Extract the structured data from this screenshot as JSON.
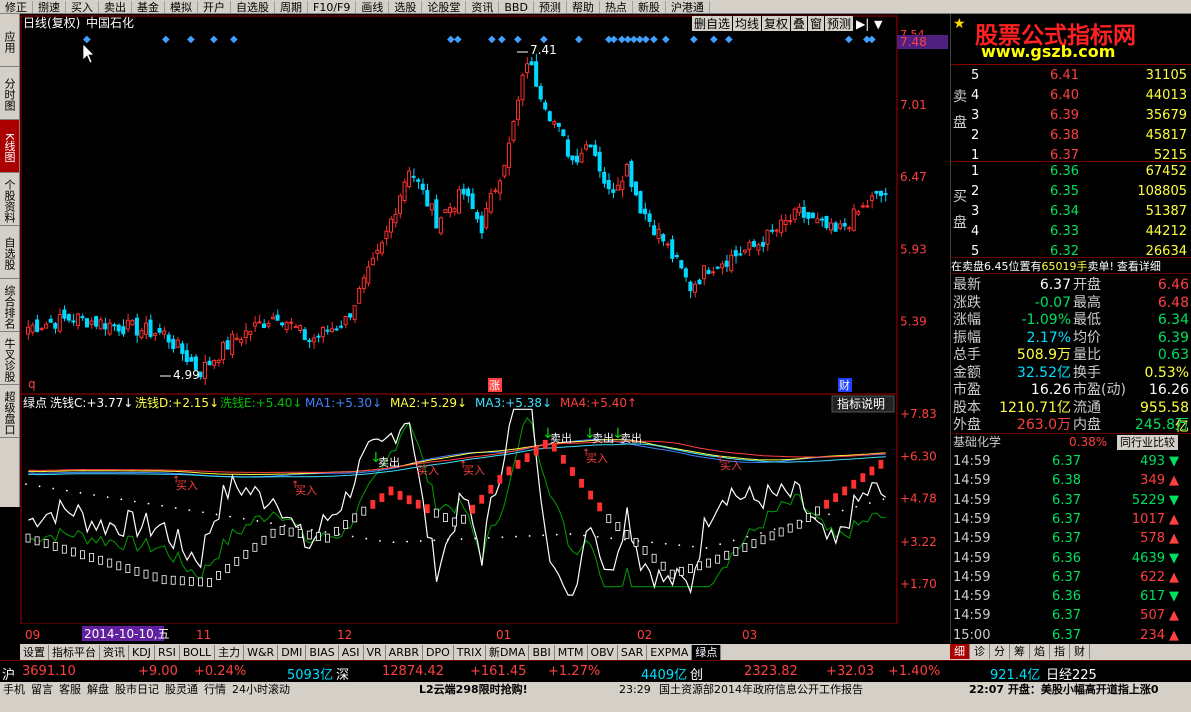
{
  "menu": [
    "修正",
    "捌速",
    "买入",
    "卖出",
    "基金",
    "模拟",
    "开户",
    "自选股",
    "周期",
    "F10/F9",
    "画线",
    "选股",
    "论股堂",
    "资讯",
    "BBD",
    "预测",
    "帮助",
    "热点",
    "新股",
    "沪港通"
  ],
  "leftnav": [
    {
      "label": "应用",
      "active": false
    },
    {
      "label": "分时图",
      "active": false
    },
    {
      "label": "K线图",
      "active": true
    },
    {
      "label": "个股资料",
      "active": false
    },
    {
      "label": "自选股",
      "active": false
    },
    {
      "label": "综合排名",
      "active": false
    },
    {
      "label": "牛叉诊股",
      "active": false
    },
    {
      "label": "超级盘口",
      "active": false
    }
  ],
  "chart": {
    "header_title": "日线(复权)",
    "stock_name": "中国石化",
    "toolbar": [
      "删自选",
      "均线",
      "复权",
      "叠",
      "窗",
      "预测"
    ],
    "price_ticks": [
      "7.48",
      "7.01",
      "6.47",
      "5.93",
      "5.39"
    ],
    "top_tick": "7.54",
    "hi_label": "7.41",
    "lo_label": "4.99",
    "markers": [
      "q",
      "涨",
      "财"
    ],
    "indicator_header": {
      "name": "绿点",
      "items": [
        {
          "label": "洗钱C:",
          "value": "+3.77",
          "color": "#ffffff",
          "arrow": "↓"
        },
        {
          "label": "洗钱D:",
          "value": "+2.15",
          "color": "#ffff40",
          "arrow": "↓"
        },
        {
          "label": "洗钱E:",
          "value": "+5.40",
          "color": "#00c000",
          "arrow": "↓"
        },
        {
          "label": "MA1:",
          "value": "+5.30",
          "color": "#4080ff",
          "arrow": "↓"
        },
        {
          "label": "MA2:",
          "value": "+5.29",
          "color": "#ffff40",
          "arrow": "↓"
        },
        {
          "label": "MA3:",
          "value": "+5.38",
          "color": "#40e0ff",
          "arrow": "↓"
        },
        {
          "label": "MA4:",
          "value": "+5.40",
          "color": "#ff4040",
          "arrow": "↑"
        }
      ]
    },
    "indicator_button": "指标说明",
    "ind_ticks": [
      "+7.83",
      "+6.30",
      "+4.78",
      "+3.22",
      "+1.70"
    ],
    "x_labels": [
      "09",
      "11",
      "12",
      "01",
      "02",
      "03"
    ],
    "date_tip": "2014-10-10,五",
    "buy_label": "买入",
    "sell_label": "卖出"
  },
  "bottomtabs": [
    {
      "label": "设置",
      "active": false
    },
    {
      "label": "指标平台",
      "active": false
    },
    {
      "label": "资讯",
      "active": false
    },
    {
      "label": "KDJ",
      "active": false
    },
    {
      "label": "RSI",
      "active": false
    },
    {
      "label": "BOLL",
      "active": false
    },
    {
      "label": "主力",
      "active": false
    },
    {
      "label": "W&R",
      "active": false
    },
    {
      "label": "DMI",
      "active": false
    },
    {
      "label": "BIAS",
      "active": false
    },
    {
      "label": "ASI",
      "active": false
    },
    {
      "label": "VR",
      "active": false
    },
    {
      "label": "ARBR",
      "active": false
    },
    {
      "label": "DPO",
      "active": false
    },
    {
      "label": "TRIX",
      "active": false
    },
    {
      "label": "新DMA",
      "active": false
    },
    {
      "label": "BBI",
      "active": false
    },
    {
      "label": "MTM",
      "active": false
    },
    {
      "label": "OBV",
      "active": false
    },
    {
      "label": "SAR",
      "active": false
    },
    {
      "label": "EXPMA",
      "active": false
    },
    {
      "label": "绿点",
      "active": true
    }
  ],
  "right": {
    "watermark_cn": "股票公式指标网",
    "watermark_url": "www.gszb.com",
    "sell_label": "卖盘",
    "buy_label": "买盘",
    "asks": [
      {
        "lvl": "5",
        "price": "6.41",
        "vol": "31105"
      },
      {
        "lvl": "4",
        "price": "6.40",
        "vol": "44013"
      },
      {
        "lvl": "3",
        "price": "6.39",
        "vol": "35679"
      },
      {
        "lvl": "2",
        "price": "6.38",
        "vol": "45817"
      },
      {
        "lvl": "1",
        "price": "6.37",
        "vol": "5215"
      }
    ],
    "bids": [
      {
        "lvl": "1",
        "price": "6.36",
        "vol": "67452"
      },
      {
        "lvl": "2",
        "price": "6.35",
        "vol": "108805"
      },
      {
        "lvl": "3",
        "price": "6.34",
        "vol": "51387"
      },
      {
        "lvl": "4",
        "price": "6.33",
        "vol": "44212"
      },
      {
        "lvl": "5",
        "price": "6.32",
        "vol": "26634"
      }
    ],
    "notice_a": "在卖盘6.45位置有",
    "notice_b": "65019手",
    "notice_c": "卖单!",
    "notice_d": "查看详细",
    "stats": [
      {
        "l1": "最新",
        "v1": "6.37",
        "c1": "#ffffff",
        "l2": "开盘",
        "v2": "6.46",
        "c2": "#ff4040"
      },
      {
        "l1": "涨跌",
        "v1": "-0.07",
        "c1": "#00e060",
        "l2": "最高",
        "v2": "6.48",
        "c2": "#ff4040"
      },
      {
        "l1": "涨幅",
        "v1": "-1.09%",
        "c1": "#00e060",
        "l2": "最低",
        "v2": "6.34",
        "c2": "#00e060"
      },
      {
        "l1": "振幅",
        "v1": "2.17%",
        "c1": "#00e0ff",
        "l2": "均价",
        "v2": "6.39",
        "c2": "#00e060"
      },
      {
        "l1": "总手",
        "v1": "508.9万",
        "c1": "#ffff40",
        "l2": "量比",
        "v2": "0.63",
        "c2": "#00e060"
      },
      {
        "l1": "金额",
        "v1": "32.52亿",
        "c1": "#00e0ff",
        "l2": "换手",
        "v2": "0.53%",
        "c2": "#ffff40"
      },
      {
        "l1": "市盈",
        "v1": "16.26",
        "c1": "#ffffff",
        "l2": "市盈(动)",
        "v2": "16.26",
        "c2": "#ffffff"
      },
      {
        "l1": "股本",
        "v1": "1210.71亿",
        "c1": "#ffff40",
        "l2": "流通",
        "v2": "955.58亿",
        "c2": "#ffff40"
      },
      {
        "l1": "外盘",
        "v1": "263.0万",
        "c1": "#ff4040",
        "l2": "内盘",
        "v2": "245.8万",
        "c2": "#00e060"
      }
    ],
    "sector": "基础化学",
    "sector_pct": "0.38%",
    "sector_btn": "同行业比较",
    "ticks": [
      {
        "t": "14:59",
        "p": "6.37",
        "v": "493",
        "up": false
      },
      {
        "t": "14:59",
        "p": "6.38",
        "v": "349",
        "up": true
      },
      {
        "t": "14:59",
        "p": "6.37",
        "v": "5229",
        "up": false
      },
      {
        "t": "14:59",
        "p": "6.37",
        "v": "1017",
        "up": true
      },
      {
        "t": "14:59",
        "p": "6.37",
        "v": "578",
        "up": true
      },
      {
        "t": "14:59",
        "p": "6.36",
        "v": "4639",
        "up": false
      },
      {
        "t": "14:59",
        "p": "6.37",
        "v": "622",
        "up": true
      },
      {
        "t": "14:59",
        "p": "6.36",
        "v": "617",
        "up": false
      },
      {
        "t": "14:59",
        "p": "6.37",
        "v": "507",
        "up": true
      },
      {
        "t": "15:00",
        "p": "6.37",
        "v": "234",
        "up": true
      }
    ],
    "tabs": [
      {
        "label": "细",
        "active": true
      },
      {
        "label": "诊",
        "active": false
      },
      {
        "label": "分",
        "active": false
      },
      {
        "label": "筹",
        "active": false
      },
      {
        "label": "焰",
        "active": false
      },
      {
        "label": "指",
        "active": false
      },
      {
        "label": "财",
        "active": false
      }
    ]
  },
  "ticker": {
    "sh": "沪",
    "sh_val": "3691.10",
    "sh_chg": "+9.00",
    "sh_pct": "+0.24%",
    "sh_amt": "5093亿",
    "sz": "深",
    "sz_val": "12874.42",
    "sz_chg": "+161.45",
    "sz_pct": "+1.27%",
    "sz_amt": "4409亿",
    "cy": "创",
    "cy_val": "2323.82",
    "cy_chg": "+32.03",
    "cy_pct": "+1.40%",
    "cy_amt": "921.4亿",
    "extra": "日经225"
  },
  "status": {
    "items": [
      "手机",
      "留言",
      "客服",
      "解盘",
      "股市日记",
      "股灵通",
      "行情",
      "24小时滚动"
    ],
    "news1": "L2云端298限时抢购!",
    "news_time": "23:29",
    "news2": "国土资源部2014年政府信息公开工作报告",
    "news3": "22:07 开盘：美股小幅高开道指上涨0"
  }
}
